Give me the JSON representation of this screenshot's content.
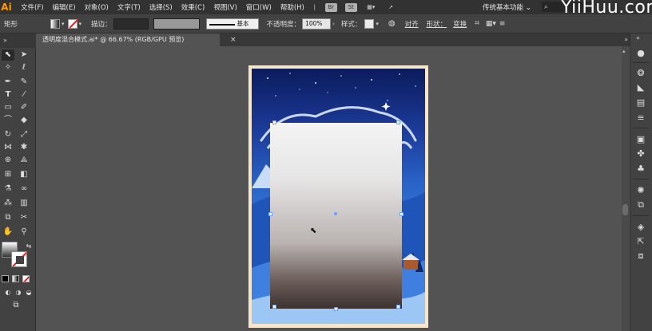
{
  "menubar": {
    "logo": "Ai",
    "items": [
      "文件(F)",
      "编辑(E)",
      "对象(O)",
      "文字(T)",
      "选择(S)",
      "效果(C)",
      "视图(V)",
      "窗口(W)",
      "帮助(H)"
    ],
    "bridge_label": "Br",
    "stock_label": "St",
    "workspace": "传统基本功能",
    "watermark": "YiiHuu.com"
  },
  "controlbar": {
    "shape_label": "矩形",
    "stroke_label": "描边：",
    "stroke_profile": "基本",
    "opacity_label": "不透明度：",
    "opacity_value": "100%",
    "style_label": "样式：",
    "align_label": "对齐",
    "shape_menu_label": "形状：",
    "transform_label": "变换"
  },
  "document": {
    "tab_title": "透明度混合模式.ai* @ 66.67% (RGB/GPU 预览)",
    "close_icon": "×"
  },
  "toolbar": {
    "collapse_icon": "»"
  },
  "colors": {
    "app_bg": "#535353",
    "panel_bg": "#424242",
    "menu_bg": "#323232",
    "accent_logo": "#ff9a00",
    "selection": "#6aa0ff"
  }
}
